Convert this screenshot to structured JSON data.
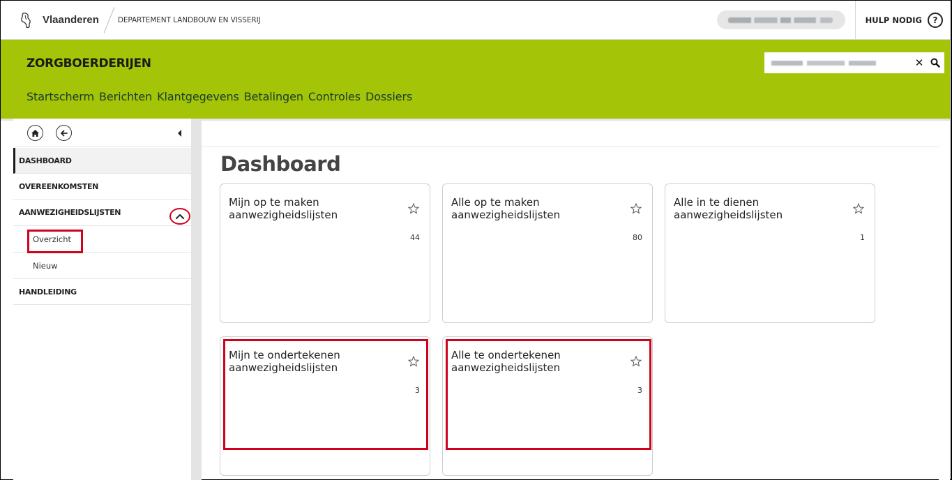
{
  "topbar": {
    "brand": "Vlaanderen",
    "department": "DEPARTEMENT LANDBOUW EN VISSERIJ",
    "help_label": "HULP NODIG",
    "help_icon": "?"
  },
  "header": {
    "app_title": "ZORGBOERDERIJEN",
    "search_clear": "✕",
    "nav": [
      "Startscherm",
      "Berichten",
      "Klantgegevens",
      "Betalingen",
      "Controles",
      "Dossiers"
    ]
  },
  "sidebar": {
    "items": [
      {
        "label": "DASHBOARD"
      },
      {
        "label": "OVEREENKOMSTEN"
      },
      {
        "label": "AANWEZIGHEIDSLIJSTEN"
      },
      {
        "label": "Overzicht"
      },
      {
        "label": "Nieuw"
      },
      {
        "label": "HANDLEIDING"
      }
    ]
  },
  "main": {
    "title": "Dashboard",
    "cards": [
      {
        "title": "Mijn op te maken aanwezigheidslijsten",
        "count": "44"
      },
      {
        "title": "Alle op te maken aanwezigheidslijsten",
        "count": "80"
      },
      {
        "title": "Alle in te dienen aanwezigheidslijsten",
        "count": "1"
      },
      {
        "title": "Mijn te ondertekenen aanwezigheidslijsten",
        "count": "3"
      },
      {
        "title": "Alle te ondertekenen aanwezigheidslijsten",
        "count": "3"
      }
    ]
  },
  "colors": {
    "brand_green": "#a4c507",
    "highlight_red": "#d0021b"
  }
}
